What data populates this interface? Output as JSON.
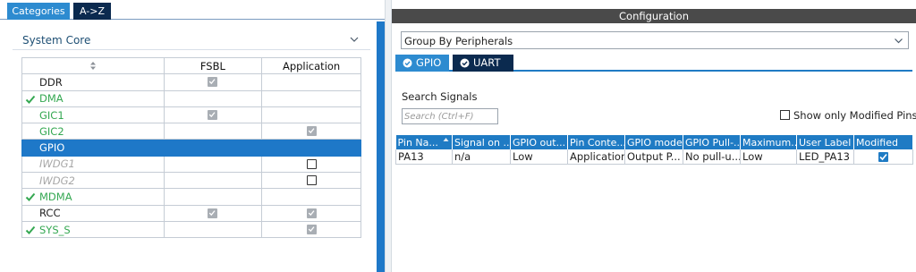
{
  "left_panel": {
    "tabs": [
      {
        "label": "Categories",
        "active": true
      },
      {
        "label": "A->Z",
        "active": false
      }
    ],
    "category": "System Core",
    "table": {
      "headers": [
        "",
        "FSBL",
        "Application"
      ],
      "rows": [
        {
          "name": "DDR",
          "style": "dark",
          "mark": false,
          "fsbl": "checked",
          "application": "none",
          "selected": false
        },
        {
          "name": "DMA",
          "style": "green",
          "mark": true,
          "fsbl": "none",
          "application": "none",
          "selected": false
        },
        {
          "name": "GIC1",
          "style": "green",
          "mark": false,
          "fsbl": "checked",
          "application": "none",
          "selected": false
        },
        {
          "name": "GIC2",
          "style": "green",
          "mark": false,
          "fsbl": "none",
          "application": "checked",
          "selected": false
        },
        {
          "name": "GPIO",
          "style": "green",
          "mark": false,
          "fsbl": "none",
          "application": "none",
          "selected": true
        },
        {
          "name": "IWDG1",
          "style": "grey",
          "mark": false,
          "fsbl": "none",
          "application": "unchecked",
          "selected": false
        },
        {
          "name": "IWDG2",
          "style": "grey",
          "mark": false,
          "fsbl": "none",
          "application": "unchecked",
          "selected": false
        },
        {
          "name": "MDMA",
          "style": "green",
          "mark": true,
          "fsbl": "none",
          "application": "none",
          "selected": false
        },
        {
          "name": "RCC",
          "style": "dark",
          "mark": false,
          "fsbl": "checked",
          "application": "checked",
          "selected": false
        },
        {
          "name": "SYS_S",
          "style": "green",
          "mark": true,
          "fsbl": "none",
          "application": "checked",
          "selected": false
        }
      ]
    }
  },
  "right_panel": {
    "title": "Configuration",
    "group_by": "Group By Peripherals",
    "tabs": [
      {
        "label": "GPIO",
        "active": true
      },
      {
        "label": "UART",
        "active": false
      }
    ],
    "search": {
      "label": "Search Signals",
      "placeholder": "Search (Ctrl+F)",
      "value": ""
    },
    "show_modified": {
      "label": "Show only Modified Pins",
      "checked": false
    },
    "pin_table": {
      "columns": [
        "Pin Na...",
        "Signal on ...",
        "GPIO out...",
        "Pin Conte...",
        "GPIO mode",
        "GPIO Pull-...",
        "Maximum...",
        "User Label",
        "Modified"
      ],
      "rows": [
        {
          "pin": "PA13",
          "signal": "n/a",
          "gpio_output": "Low",
          "pin_context": "Application",
          "gpio_mode": "Output P...",
          "gpio_pull": "No pull-u...",
          "maximum": "Low",
          "user_label": "LED_PA13",
          "modified": true
        }
      ]
    }
  },
  "colors": {
    "tab_active": "#2d8bd0",
    "tab_inactive": "#0b2a4f",
    "selection": "#1e78c8",
    "enabled_green": "#35a852",
    "header_bar": "#4a4a4a"
  }
}
